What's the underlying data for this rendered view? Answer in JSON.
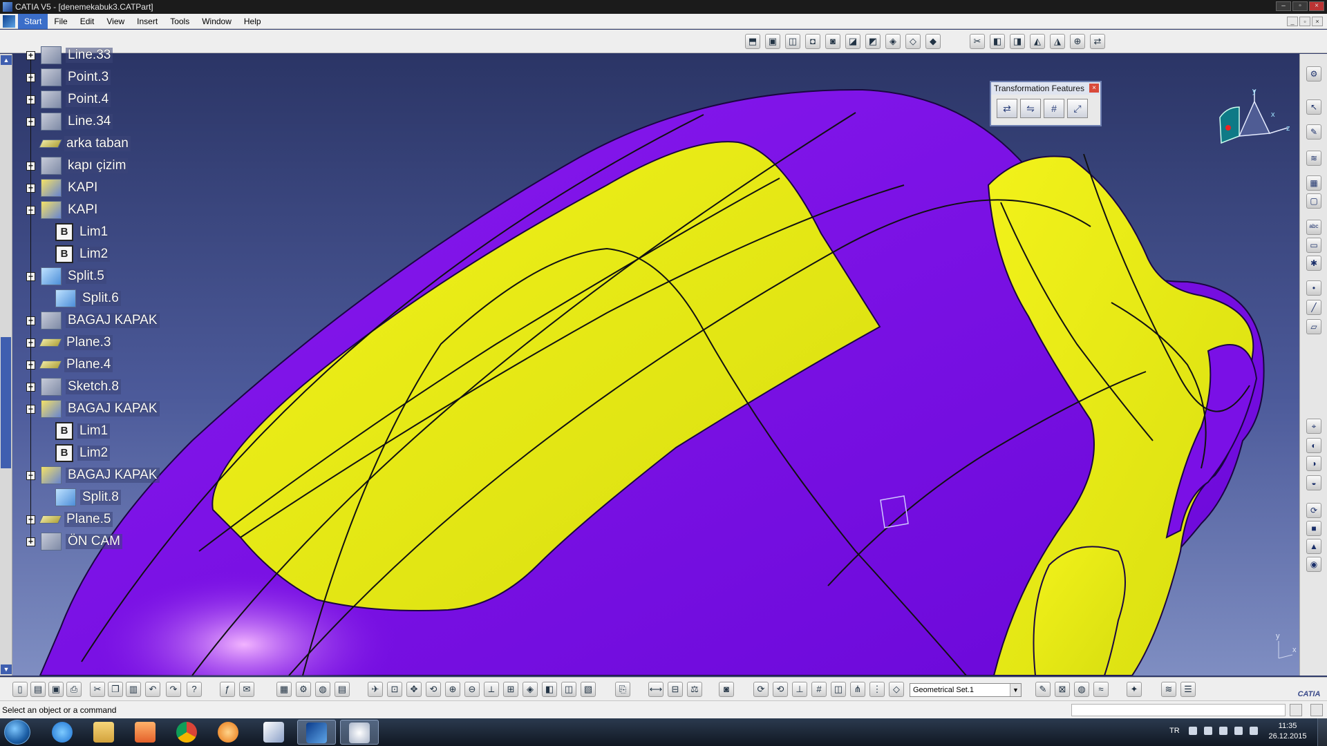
{
  "window": {
    "title": "CATIA V5 - [denemekabuk3.CATPart]",
    "buttons": [
      "–",
      "▫",
      "×"
    ]
  },
  "menu": {
    "items": [
      "Start",
      "File",
      "Edit",
      "View",
      "Insert",
      "Tools",
      "Window",
      "Help"
    ],
    "mdi_buttons": [
      "_",
      "▫",
      "×"
    ]
  },
  "tree": {
    "nodes": [
      {
        "label": "Line.33",
        "icon": "line-icon",
        "expand": "+"
      },
      {
        "label": "Point.3",
        "icon": "point-icon",
        "expand": "+"
      },
      {
        "label": "Point.4",
        "icon": "point-icon",
        "expand": "+"
      },
      {
        "label": "Line.34",
        "icon": "line-icon",
        "expand": "+"
      },
      {
        "label": "arka taban",
        "icon": "plane-icon",
        "expand": ""
      },
      {
        "label": "kapı çizim",
        "icon": "sketch-icon",
        "expand": "+"
      },
      {
        "label": "KAPI",
        "icon": "surface-icon",
        "expand": "+"
      },
      {
        "label": "KAPI",
        "icon": "surface-icon",
        "expand": "−"
      },
      {
        "label": "Lim1",
        "icon": "boundary-icon",
        "expand": ""
      },
      {
        "label": "Lim2",
        "icon": "boundary-icon",
        "expand": ""
      },
      {
        "label": "Split.5",
        "icon": "split-icon",
        "expand": "−"
      },
      {
        "label": "Split.6",
        "icon": "split-icon",
        "expand": ""
      },
      {
        "label": "BAGAJ KAPAK",
        "icon": "sketch-icon",
        "expand": "+"
      },
      {
        "label": "Plane.3",
        "icon": "plane-icon",
        "expand": "+"
      },
      {
        "label": "Plane.4",
        "icon": "plane-icon",
        "expand": "+"
      },
      {
        "label": "Sketch.8",
        "icon": "sketch-icon",
        "expand": "+"
      },
      {
        "label": "BAGAJ KAPAK",
        "icon": "surface-icon",
        "expand": "−"
      },
      {
        "label": "Lim1",
        "icon": "boundary-icon",
        "expand": ""
      },
      {
        "label": "Lim2",
        "icon": "boundary-icon",
        "expand": ""
      },
      {
        "label": "BAGAJ KAPAK",
        "icon": "surface-icon",
        "expand": "−"
      },
      {
        "label": "Split.8",
        "icon": "split-icon",
        "expand": ""
      },
      {
        "label": "Plane.5",
        "icon": "plane-icon",
        "expand": "+"
      },
      {
        "label": "ÖN CAM",
        "icon": "sketch-icon",
        "expand": "+"
      }
    ],
    "lim_glyph": "B"
  },
  "transformation_toolbar": {
    "title": "Transformation Features",
    "close": "×",
    "buttons": [
      {
        "name": "translate-icon",
        "glyph": "⇄"
      },
      {
        "name": "symmetry-icon",
        "glyph": "⇋"
      },
      {
        "name": "pattern-icon",
        "glyph": "#"
      },
      {
        "name": "scaling-icon",
        "glyph": "⤢"
      }
    ]
  },
  "compass": {
    "x": "x",
    "y": "y",
    "z": "z"
  },
  "axis_indicator": {
    "y": "y",
    "x": "x"
  },
  "geometrical_set": {
    "value": "Geometrical Set.1",
    "arrow": "▼"
  },
  "catia_logo": "CATIA",
  "status": {
    "message": "Select an object or a command"
  },
  "taskbar": {
    "language": "TR",
    "time": "11:35",
    "date": "26.12.2015"
  },
  "colors": {
    "car_body": "#7a10e6",
    "panels": "#e8ea12",
    "viewport_top": "#2b3566",
    "viewport_bottom": "#7f8ec2"
  }
}
